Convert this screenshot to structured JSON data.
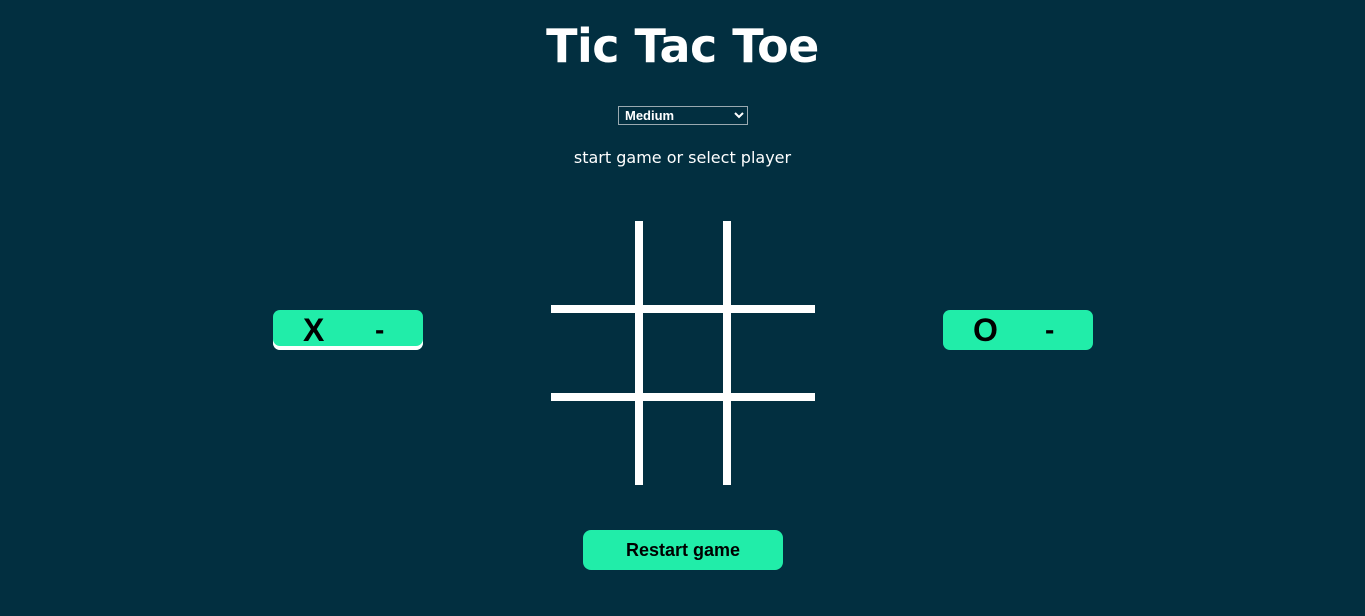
{
  "title": "Tic Tac Toe",
  "difficulty": {
    "selected": "Medium",
    "options": [
      "Medium"
    ]
  },
  "status": "start game or select player",
  "board": {
    "cells": [
      "",
      "",
      "",
      "",
      "",
      "",
      "",
      "",
      ""
    ]
  },
  "players": {
    "x": {
      "mark": "X",
      "score": "-",
      "active": true
    },
    "o": {
      "mark": "O",
      "score": "-",
      "active": false
    }
  },
  "restart_label": "Restart game",
  "colors": {
    "background": "#022f40",
    "accent": "#21eda9",
    "text": "#ffffff"
  }
}
